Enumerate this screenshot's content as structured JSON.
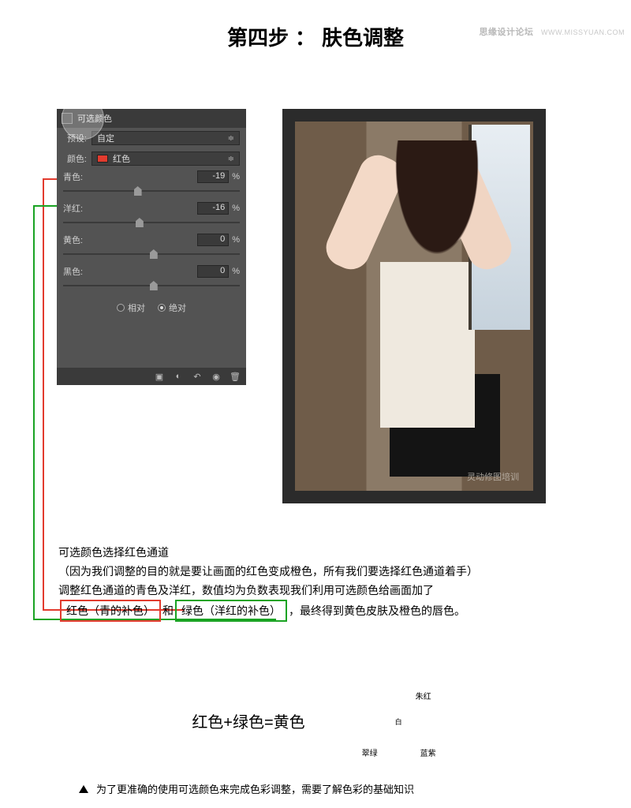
{
  "watermark": {
    "site": "思缘设计论坛",
    "url": "WWW.MISSYUAN.COM"
  },
  "title": {
    "step": "第四步",
    "colon": "：",
    "name": "肤色调整"
  },
  "panel": {
    "tab_title": "可选颜色",
    "preset_label": "预设:",
    "preset_value": "自定",
    "color_label": "颜色:",
    "color_value": "红色",
    "sliders": {
      "cyan": {
        "label": "青色:",
        "value": "-19",
        "pct": "%"
      },
      "magenta": {
        "label": "洋红:",
        "value": "-16",
        "pct": "%"
      },
      "yellow": {
        "label": "黄色:",
        "value": "0",
        "pct": "%"
      },
      "black": {
        "label": "黑色:",
        "value": "0",
        "pct": "%"
      }
    },
    "radio": {
      "relative": "相对",
      "absolute": "绝对"
    }
  },
  "image": {
    "caption": "灵动修图培训"
  },
  "explain": {
    "l1": "可选颜色选择红色通道",
    "l2": "（因为我们调整的目的就是要让画面的红色变成橙色，所有我们要选择红色通道着手）",
    "l3": "调整红色通道的青色及洋红，数值均为负数表现我们利用可选颜色给画面加了",
    "l4a": "红色（青的补色）",
    "l4b": "和",
    "l4c": "绿色（洋红的补色）",
    "l4d": "，最终得到黄色皮肤及橙色的唇色。"
  },
  "formula": {
    "text": "红色+绿色=黄色"
  },
  "venn": {
    "r": "朱红",
    "g": "翠绿",
    "b": "蓝紫",
    "w": "白"
  },
  "note": {
    "text": "为了更准确的使用可选颜色来完成色彩调整，需要了解色彩的基础知识"
  }
}
